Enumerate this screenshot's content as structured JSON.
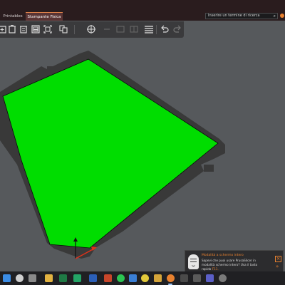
{
  "tabs": [
    {
      "label": "Printables",
      "active": false
    },
    {
      "label": "Stampante Fisica",
      "active": true
    }
  ],
  "search": {
    "placeholder": "Inserire un termine di ricerca"
  },
  "colors": {
    "accent": "#e8812f",
    "bed": "#00dd00",
    "bed_frame": "#3a3a3a",
    "background": "#56595c"
  },
  "toolbar_icons": [
    "add-object-icon",
    "delete-icon",
    "delete-all-icon",
    "arrange-icon",
    "copy-icon",
    "paste-icon",
    "add-instance-icon",
    "remove-instance-icon",
    "split-objects-icon",
    "split-parts-icon",
    "variable-layer-height-icon",
    "undo-icon",
    "redo-icon"
  ],
  "notification": {
    "title": "Modalità a schermo intero",
    "body": "Sapevi che puoi usare PrusaSlicer in modalità schermo intero? Usa il tasto rapido",
    "hotkey": "F11."
  },
  "taskbar_icons": [
    "start-icon",
    "search-icon",
    "task-view-icon",
    "file-explorer-icon",
    "excel-icon",
    "sheets-icon",
    "word-icon",
    "powerpoint-icon",
    "whatsapp-icon",
    "onedrive-icon",
    "chrome-icon",
    "folder-icon",
    "prusaslicer-icon",
    "app-icon",
    "app-icon-2",
    "teams-icon",
    "settings-icon"
  ]
}
